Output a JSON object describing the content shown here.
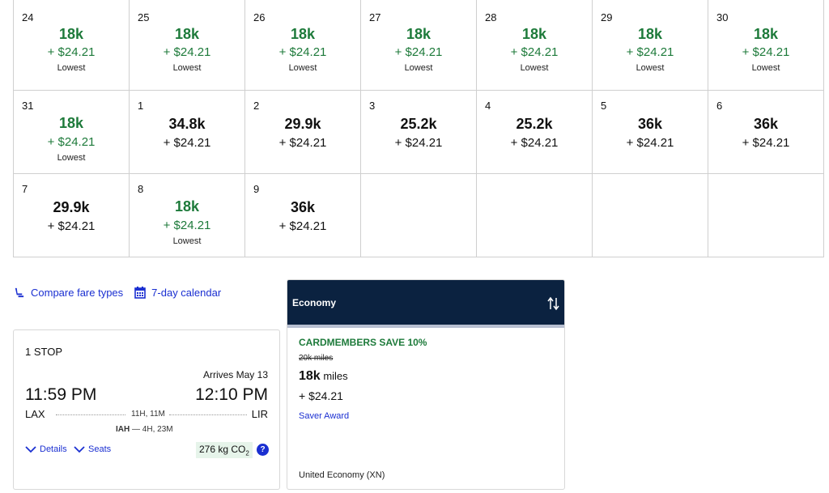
{
  "calendar": {
    "rows": [
      [
        {
          "day": "24",
          "miles": "18k",
          "tax": "+ $24.21",
          "note": "Lowest"
        },
        {
          "day": "25",
          "miles": "18k",
          "tax": "+ $24.21",
          "note": "Lowest"
        },
        {
          "day": "26",
          "miles": "18k",
          "tax": "+ $24.21",
          "note": "Lowest"
        },
        {
          "day": "27",
          "miles": "18k",
          "tax": "+ $24.21",
          "note": "Lowest"
        },
        {
          "day": "28",
          "miles": "18k",
          "tax": "+ $24.21",
          "note": "Lowest"
        },
        {
          "day": "29",
          "miles": "18k",
          "tax": "+ $24.21",
          "note": "Lowest"
        },
        {
          "day": "30",
          "miles": "18k",
          "tax": "+ $24.21",
          "note": "Lowest"
        }
      ],
      [
        {
          "day": "31",
          "miles": "18k",
          "tax": "+ $24.21",
          "note": "Lowest"
        },
        {
          "day": "1",
          "miles": "34.8k",
          "tax": "+ $24.21",
          "note": ""
        },
        {
          "day": "2",
          "miles": "29.9k",
          "tax": "+ $24.21",
          "note": ""
        },
        {
          "day": "3",
          "miles": "25.2k",
          "tax": "+ $24.21",
          "note": ""
        },
        {
          "day": "4",
          "miles": "25.2k",
          "tax": "+ $24.21",
          "note": ""
        },
        {
          "day": "5",
          "miles": "36k",
          "tax": "+ $24.21",
          "note": ""
        },
        {
          "day": "6",
          "miles": "36k",
          "tax": "+ $24.21",
          "note": ""
        }
      ],
      [
        {
          "day": "7",
          "miles": "29.9k",
          "tax": "+ $24.21",
          "note": ""
        },
        {
          "day": "8",
          "miles": "18k",
          "tax": "+ $24.21",
          "note": "Lowest"
        },
        {
          "day": "9",
          "miles": "36k",
          "tax": "+ $24.21",
          "note": ""
        },
        {
          "day": "",
          "miles": "",
          "tax": "",
          "note": ""
        },
        {
          "day": "",
          "miles": "",
          "tax": "",
          "note": ""
        },
        {
          "day": "",
          "miles": "",
          "tax": "",
          "note": ""
        },
        {
          "day": "",
          "miles": "",
          "tax": "",
          "note": ""
        }
      ]
    ]
  },
  "links": {
    "compare": "Compare fare types",
    "calendar7": "7-day calendar"
  },
  "flight": {
    "stops": "1 STOP",
    "arrives": "Arrives May 13",
    "dep_time": "11:59 PM",
    "arr_time": "12:10 PM",
    "from": "LAX",
    "to": "LIR",
    "duration": "11H, 11M",
    "connection_airport": "IAH",
    "connection_time": " — 4H, 23M",
    "details": "Details",
    "seats": "Seats",
    "co2_value": "276 kg CO",
    "co2_sub": "2",
    "help": "?"
  },
  "fare": {
    "cabin_header": "Economy",
    "promo": "CARDMEMBERS SAVE 10%",
    "old_price": "20k miles",
    "miles_value": "18k",
    "miles_unit": " miles",
    "tax": "+ $24.21",
    "award": "Saver Award",
    "cabin_detail": "United Economy (XN)"
  },
  "colors": {
    "lowest_green": "#1d7a3a",
    "link_blue": "#1a2fd1",
    "header_navy": "#0b2240"
  }
}
